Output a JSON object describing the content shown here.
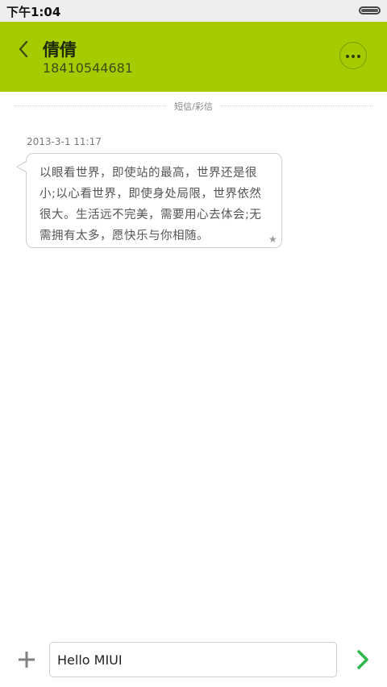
{
  "status_bar": {
    "time": "下午1:04",
    "battery_icon": "battery-icon"
  },
  "header": {
    "background": "#a8ca00",
    "back_icon": "chevron-left-icon",
    "contact_name": "倩倩",
    "contact_number": "18410544681",
    "more_icon": "more-dots-icon"
  },
  "thread": {
    "channel_label": "短信/彩信",
    "messages": [
      {
        "timestamp": "2013-3-1 11:17",
        "text": "以眼看世界，即使站的最高，世界还是很小;以心看世界，即使身处局限，世界依然很大。生活远不完美，需要用心去体会;无需拥有太多，愿快乐与你相随。",
        "star_icon": "star-icon"
      }
    ]
  },
  "composer": {
    "add_icon": "plus-icon",
    "input_value": "Hello MIUI",
    "send_icon": "send-chevron-icon",
    "send_color": "#2fb84a"
  }
}
